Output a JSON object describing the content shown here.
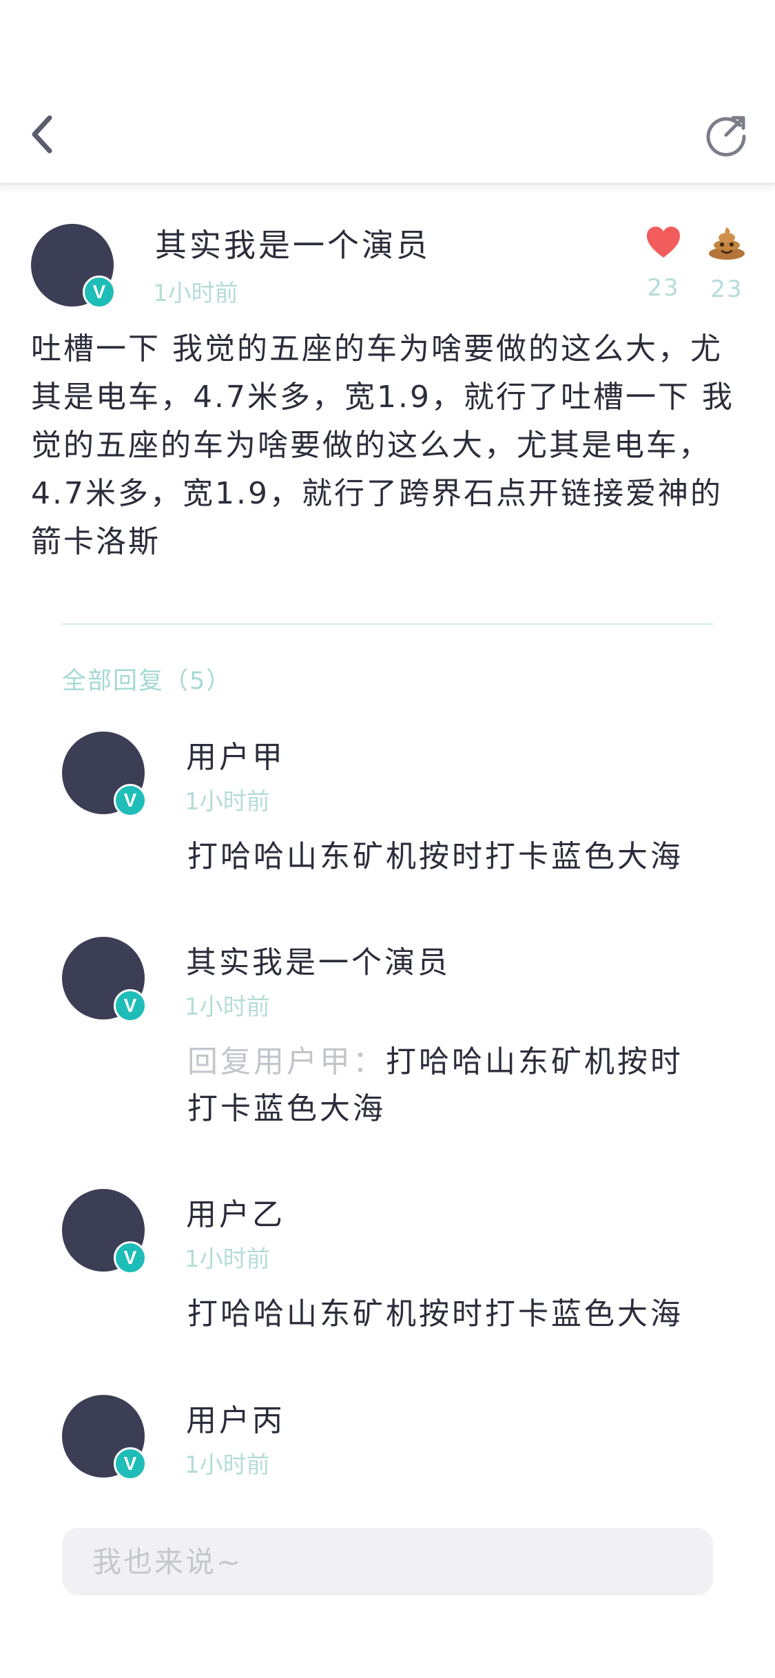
{
  "header": {
    "back_icon": "chevron-left-icon",
    "share_icon": "share-refresh-icon"
  },
  "post": {
    "author": "其实我是一个演员",
    "time": "1小时前",
    "verified_badge": "V",
    "likes": "23",
    "poops": "23",
    "like_icon": "heart-icon",
    "poop_icon": "poop-icon",
    "content": "吐槽一下 我觉的五座的车为啥要做的这么大，尤其是电车，4.7米多，宽1.9，就行了吐槽一下 我觉的五座的车为啥要做的这么大，尤其是电车，4.7米多，宽1.9，就行了跨界石点开链接爱神的箭卡洛斯"
  },
  "replies_heading": "全部回复（5）",
  "replies": [
    {
      "name": "用户甲",
      "time": "1小时前",
      "badge": "V",
      "prefix": "",
      "content": "打哈哈山东矿机按时打卡蓝色大海"
    },
    {
      "name": "其实我是一个演员",
      "time": "1小时前",
      "badge": "V",
      "prefix": "回复用户甲：",
      "content": "打哈哈山东矿机按时打卡蓝色大海"
    },
    {
      "name": "用户乙",
      "time": "1小时前",
      "badge": "V",
      "prefix": "",
      "content": "打哈哈山东矿机按时打卡蓝色大海"
    },
    {
      "name": "用户丙",
      "time": "1小时前",
      "badge": "V",
      "prefix": "",
      "content": ""
    }
  ],
  "comment_input": {
    "placeholder": "我也来说~",
    "value": ""
  },
  "colors": {
    "accent": "#1ebdb8",
    "avatar": "#3b3e54",
    "heart": "#f25c5c",
    "muted_teal": "#b5dcd8",
    "text": "#2b2d3a"
  }
}
